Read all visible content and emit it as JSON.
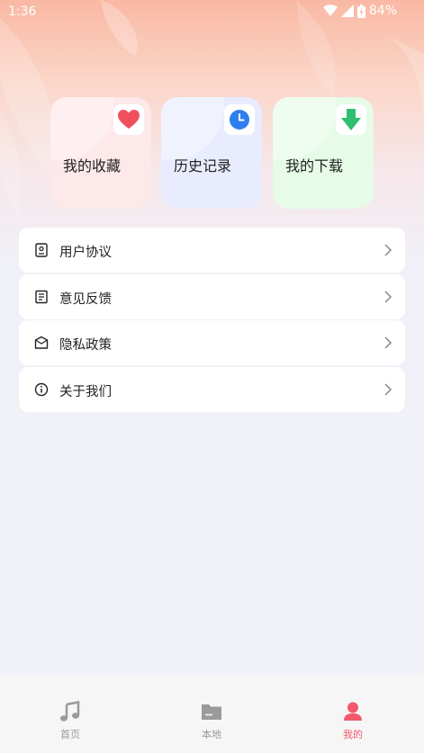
{
  "status_bar": {
    "time": "1:36",
    "battery": "84%",
    "icons": [
      "wifi-icon",
      "cell-signal-icon",
      "battery-icon"
    ]
  },
  "quick_cards": [
    {
      "label": "我的收藏",
      "icon": "heart-icon",
      "color": "#f0505e"
    },
    {
      "label": "历史记录",
      "icon": "clock-icon",
      "color": "#2f7ef0"
    },
    {
      "label": "我的下载",
      "icon": "download-arrow-icon",
      "color": "#2fbf70"
    }
  ],
  "menu": [
    {
      "label": "用户协议",
      "icon": "agreement-icon"
    },
    {
      "label": "意见反馈",
      "icon": "feedback-icon"
    },
    {
      "label": "隐私政策",
      "icon": "privacy-icon"
    },
    {
      "label": "关于我们",
      "icon": "info-icon"
    }
  ],
  "bottom_nav": {
    "items": [
      {
        "label": "首页",
        "icon": "music-note-icon",
        "active": false
      },
      {
        "label": "本地",
        "icon": "folder-icon",
        "active": false
      },
      {
        "label": "我的",
        "icon": "user-icon",
        "active": true
      }
    ],
    "active_color": "#f05a6a",
    "inactive_color": "#999999"
  }
}
